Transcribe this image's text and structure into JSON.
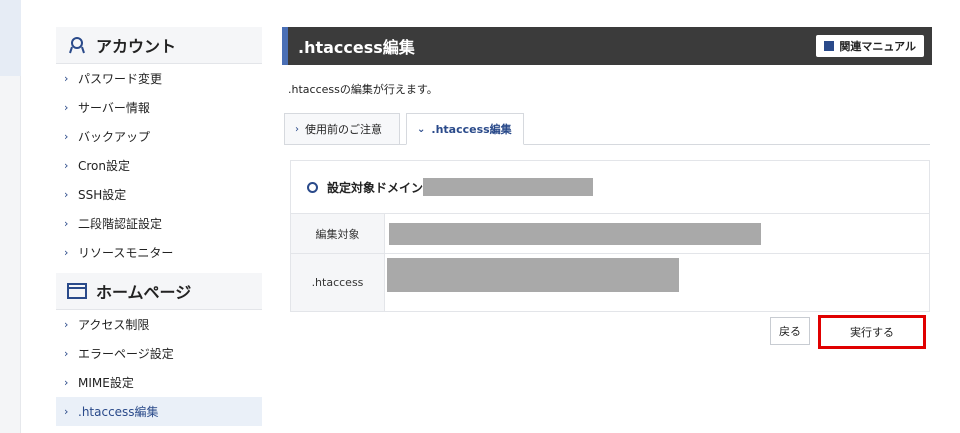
{
  "sidebar": {
    "account": {
      "title": "アカウント",
      "items": [
        "パスワード変更",
        "サーバー情報",
        "バックアップ",
        "Cron設定",
        "SSH設定",
        "二段階認証設定",
        "リソースモニター"
      ]
    },
    "homepage": {
      "title": "ホームページ",
      "items": [
        "アクセス制限",
        "エラーページ設定",
        "MIME設定",
        ".htaccess編集"
      ]
    }
  },
  "main": {
    "title": ".htaccess編集",
    "manual_label": "関連マニュアル",
    "description": ".htaccessの編集が行えます。",
    "tabs": [
      {
        "label": "使用前のご注意"
      },
      {
        "label": ".htaccess編集"
      }
    ],
    "domain_label": "設定対象ドメイン",
    "rows": [
      {
        "label": "編集対象"
      },
      {
        "label": ".htaccess"
      }
    ],
    "back_label": "戻る",
    "run_label": "実行する"
  },
  "colors": {
    "accent": "#2a4a8a",
    "header_bg": "#3b3b3b",
    "highlight": "#e00000"
  }
}
